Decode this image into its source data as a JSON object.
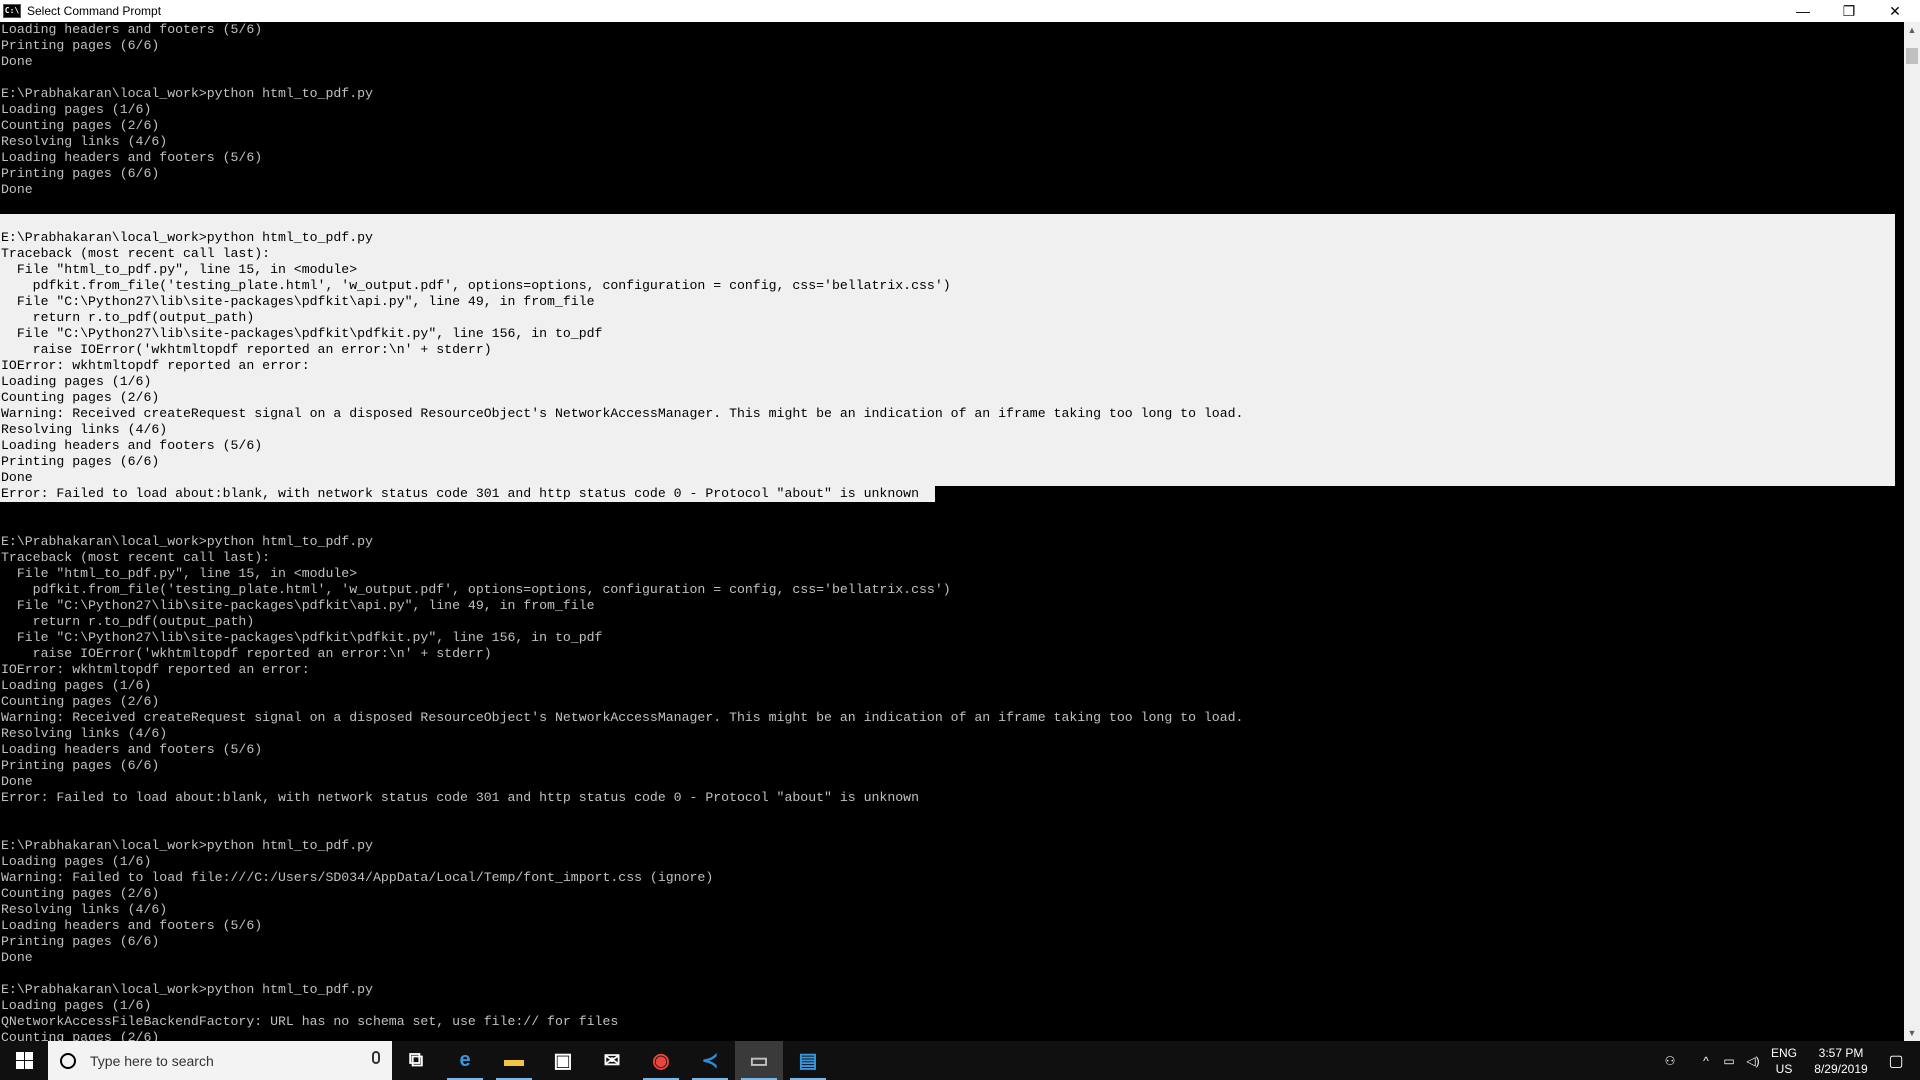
{
  "window": {
    "title": "Select Command Prompt",
    "minimize_glyph": "—",
    "maximize_glyph": "❐",
    "close_glyph": "✕",
    "icon_text": "C:\\"
  },
  "console_lines": [
    {
      "text": "Loading headers and footers (5/6)",
      "sel": 0
    },
    {
      "text": "Printing pages (6/6)",
      "sel": 0
    },
    {
      "text": "Done",
      "sel": 0
    },
    {
      "text": "",
      "sel": 0
    },
    {
      "text": "E:\\Prabhakaran\\local_work>python html_to_pdf.py",
      "sel": 0
    },
    {
      "text": "Loading pages (1/6)",
      "sel": 0
    },
    {
      "text": "Counting pages (2/6)",
      "sel": 0
    },
    {
      "text": "Resolving links (4/6)",
      "sel": 0
    },
    {
      "text": "Loading headers and footers (5/6)",
      "sel": 0
    },
    {
      "text": "Printing pages (6/6)",
      "sel": 0
    },
    {
      "text": "Done",
      "sel": 0
    },
    {
      "text": "",
      "sel": 0
    },
    {
      "text": "",
      "sel": 1
    },
    {
      "text": "E:\\Prabhakaran\\local_work>python html_to_pdf.py",
      "sel": 1
    },
    {
      "text": "Traceback (most recent call last):",
      "sel": 1
    },
    {
      "text": "  File \"html_to_pdf.py\", line 15, in <module>",
      "sel": 1
    },
    {
      "text": "    pdfkit.from_file('testing_plate.html', 'w_output.pdf', options=options, configuration = config, css='bellatrix.css')",
      "sel": 1
    },
    {
      "text": "  File \"C:\\Python27\\lib\\site-packages\\pdfkit\\api.py\", line 49, in from_file",
      "sel": 1
    },
    {
      "text": "    return r.to_pdf(output_path)",
      "sel": 1
    },
    {
      "text": "  File \"C:\\Python27\\lib\\site-packages\\pdfkit\\pdfkit.py\", line 156, in to_pdf",
      "sel": 1
    },
    {
      "text": "    raise IOError('wkhtmltopdf reported an error:\\n' + stderr)",
      "sel": 1
    },
    {
      "text": "IOError: wkhtmltopdf reported an error:",
      "sel": 1
    },
    {
      "text": "Loading pages (1/6)",
      "sel": 1
    },
    {
      "text": "Counting pages (2/6)",
      "sel": 1
    },
    {
      "text": "Warning: Received createRequest signal on a disposed ResourceObject's NetworkAccessManager. This might be an indication of an iframe taking too long to load.",
      "sel": 1
    },
    {
      "text": "Resolving links (4/6)",
      "sel": 1
    },
    {
      "text": "Loading headers and footers (5/6)",
      "sel": 1
    },
    {
      "text": "Printing pages (6/6)",
      "sel": 1
    },
    {
      "text": "Done",
      "sel": 1
    },
    {
      "text": "Error: Failed to load about:blank, with network status code 301 and http status code 0 - Protocol \"about\" is unknown",
      "sel": 2
    },
    {
      "text": "",
      "sel": 0
    },
    {
      "text": "",
      "sel": 0
    },
    {
      "text": "E:\\Prabhakaran\\local_work>python html_to_pdf.py",
      "sel": 0
    },
    {
      "text": "Traceback (most recent call last):",
      "sel": 0
    },
    {
      "text": "  File \"html_to_pdf.py\", line 15, in <module>",
      "sel": 0
    },
    {
      "text": "    pdfkit.from_file('testing_plate.html', 'w_output.pdf', options=options, configuration = config, css='bellatrix.css')",
      "sel": 0
    },
    {
      "text": "  File \"C:\\Python27\\lib\\site-packages\\pdfkit\\api.py\", line 49, in from_file",
      "sel": 0
    },
    {
      "text": "    return r.to_pdf(output_path)",
      "sel": 0
    },
    {
      "text": "  File \"C:\\Python27\\lib\\site-packages\\pdfkit\\pdfkit.py\", line 156, in to_pdf",
      "sel": 0
    },
    {
      "text": "    raise IOError('wkhtmltopdf reported an error:\\n' + stderr)",
      "sel": 0
    },
    {
      "text": "IOError: wkhtmltopdf reported an error:",
      "sel": 0
    },
    {
      "text": "Loading pages (1/6)",
      "sel": 0
    },
    {
      "text": "Counting pages (2/6)",
      "sel": 0
    },
    {
      "text": "Warning: Received createRequest signal on a disposed ResourceObject's NetworkAccessManager. This might be an indication of an iframe taking too long to load.",
      "sel": 0
    },
    {
      "text": "Resolving links (4/6)",
      "sel": 0
    },
    {
      "text": "Loading headers and footers (5/6)",
      "sel": 0
    },
    {
      "text": "Printing pages (6/6)",
      "sel": 0
    },
    {
      "text": "Done",
      "sel": 0
    },
    {
      "text": "Error: Failed to load about:blank, with network status code 301 and http status code 0 - Protocol \"about\" is unknown",
      "sel": 0
    },
    {
      "text": "",
      "sel": 0
    },
    {
      "text": "",
      "sel": 0
    },
    {
      "text": "E:\\Prabhakaran\\local_work>python html_to_pdf.py",
      "sel": 0
    },
    {
      "text": "Loading pages (1/6)",
      "sel": 0
    },
    {
      "text": "Warning: Failed to load file:///C:/Users/SD034/AppData/Local/Temp/font_import.css (ignore)",
      "sel": 0
    },
    {
      "text": "Counting pages (2/6)",
      "sel": 0
    },
    {
      "text": "Resolving links (4/6)",
      "sel": 0
    },
    {
      "text": "Loading headers and footers (5/6)",
      "sel": 0
    },
    {
      "text": "Printing pages (6/6)",
      "sel": 0
    },
    {
      "text": "Done",
      "sel": 0
    },
    {
      "text": "",
      "sel": 0
    },
    {
      "text": "E:\\Prabhakaran\\local_work>python html_to_pdf.py",
      "sel": 0
    },
    {
      "text": "Loading pages (1/6)",
      "sel": 0
    },
    {
      "text": "QNetworkAccessFileBackendFactory: URL has no schema set, use file:// for files",
      "sel": 0
    },
    {
      "text": "Counting pages (2/6)",
      "sel": 0
    }
  ],
  "taskbar": {
    "search_placeholder": "Type here to search",
    "apps": [
      {
        "name": "task-view",
        "glyph": "⧉",
        "color": "#ffffff",
        "open": false,
        "active": false
      },
      {
        "name": "edge",
        "glyph": "e",
        "color": "#3a96dd",
        "open": true,
        "active": false
      },
      {
        "name": "file-explorer",
        "glyph": "▬",
        "color": "#f5c342",
        "open": true,
        "active": false
      },
      {
        "name": "store",
        "glyph": "▣",
        "color": "#ffffff",
        "open": false,
        "active": false
      },
      {
        "name": "mail",
        "glyph": "✉",
        "color": "#ffffff",
        "open": false,
        "active": false
      },
      {
        "name": "chrome",
        "glyph": "◉",
        "color": "#e8453c",
        "open": true,
        "active": false
      },
      {
        "name": "vscode",
        "glyph": "≺",
        "color": "#2b8fd6",
        "open": true,
        "active": false
      },
      {
        "name": "command-prompt",
        "glyph": "▭",
        "color": "#c0c0c0",
        "open": true,
        "active": true
      },
      {
        "name": "remote-desktop",
        "glyph": "▤",
        "color": "#3a96dd",
        "open": true,
        "active": false
      }
    ],
    "tray": {
      "lang_top": "ENG",
      "lang_bottom": "US",
      "time": "3:57 PM",
      "date": "8/29/2019"
    }
  },
  "colors": {
    "console_bg": "#000000",
    "console_text": "#c0c0c0",
    "selection_bg": "#f0f0f0",
    "taskbar_bg": "#101010",
    "accent": "#76b9ed"
  }
}
